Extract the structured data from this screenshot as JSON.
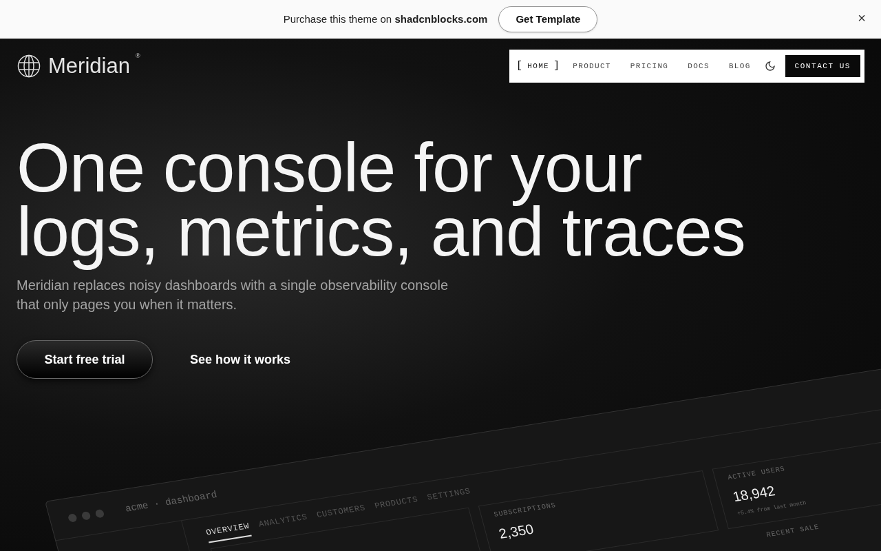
{
  "banner": {
    "text": "Purchase this theme on **shadcnblocks.com**",
    "button": "Get Template",
    "close": "×"
  },
  "brand": {
    "name": "Meridian",
    "mark": "®"
  },
  "nav": {
    "items": [
      {
        "label": "HOME",
        "selected": true
      },
      {
        "label": "PRODUCT",
        "selected": false
      },
      {
        "label": "PRICING",
        "selected": false
      },
      {
        "label": "DOCS",
        "selected": false
      },
      {
        "label": "BLOG",
        "selected": false
      }
    ],
    "bracket_open": "[",
    "bracket_close": "]",
    "cta": "CONTACT US"
  },
  "hero": {
    "lines": [
      "One console for your",
      "logs, metrics, and traces"
    ],
    "subtitle": "Meridian replaces noisy dashboards with a single observability console that only pages you when it matters.",
    "primary": "Start free trial",
    "secondary": "See how it works"
  },
  "dashboard": {
    "title": "acme · dashboard",
    "tabs": [
      {
        "label": "OVERVIEW",
        "selected": true
      },
      {
        "label": "ANALYTICS",
        "selected": false
      },
      {
        "label": "CUSTOMERS",
        "selected": false
      },
      {
        "label": "PRODUCTS",
        "selected": false
      },
      {
        "label": "SETTINGS",
        "selected": false
      }
    ],
    "cards": [
      {
        "label": "SUBSCRIPTIONS",
        "value": "2,350"
      },
      {
        "label": "ACTIVE USERS",
        "value": "18,942",
        "note": "+5.4% from last month"
      }
    ],
    "recent": "RECENT SALE"
  }
}
